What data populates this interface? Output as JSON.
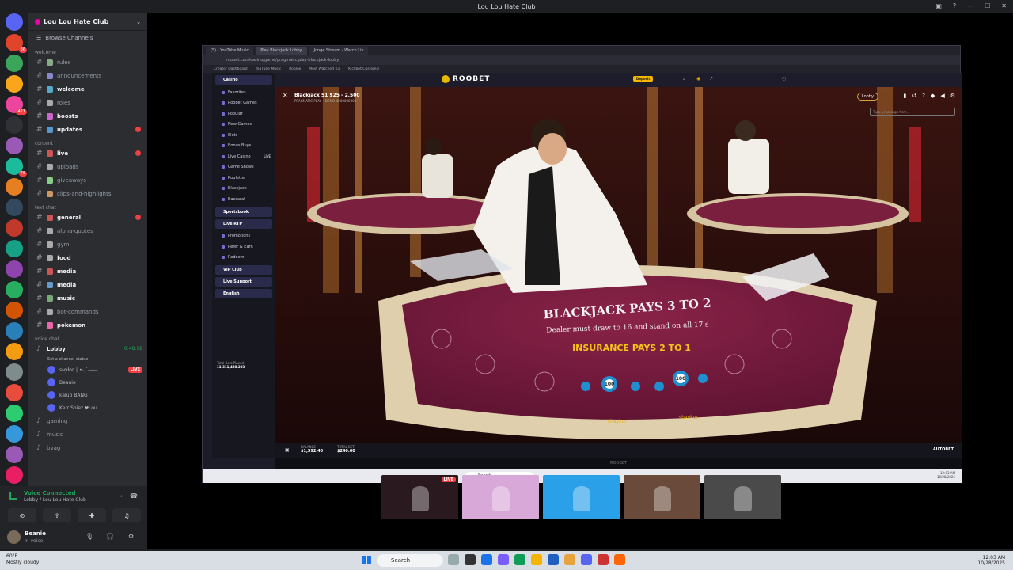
{
  "window": {
    "title": "Lou Lou Hate Club"
  },
  "server": {
    "name": "Lou Lou Hate Club",
    "browse_label": "Browse Channels",
    "categories": [
      {
        "name": "welcome",
        "channels": [
          {
            "name": "rules",
            "bold": false,
            "ping": false
          },
          {
            "name": "announcements",
            "bold": false,
            "ping": false
          },
          {
            "name": "welcome",
            "bold": true,
            "ping": false
          },
          {
            "name": "roles",
            "bold": false,
            "ping": false
          },
          {
            "name": "boosts",
            "bold": true,
            "ping": false
          },
          {
            "name": "updates",
            "bold": true,
            "ping": true
          }
        ]
      },
      {
        "name": "content",
        "channels": [
          {
            "name": "live",
            "bold": true,
            "ping": true
          },
          {
            "name": "uploads",
            "bold": false,
            "ping": false
          },
          {
            "name": "giveaways",
            "bold": false,
            "ping": false
          },
          {
            "name": "clips-and-highlights",
            "bold": false,
            "ping": false
          }
        ]
      },
      {
        "name": "text chat",
        "channels": [
          {
            "name": "general",
            "bold": true,
            "ping": true
          },
          {
            "name": "alpha-quotes",
            "bold": false,
            "ping": false
          },
          {
            "name": "gym",
            "bold": false,
            "ping": false
          },
          {
            "name": "food",
            "bold": true,
            "ping": false
          },
          {
            "name": "media",
            "bold": true,
            "ping": false
          },
          {
            "name": "media",
            "bold": true,
            "ping": false
          },
          {
            "name": "music",
            "bold": true,
            "ping": false
          },
          {
            "name": "bot-commands",
            "bold": false,
            "ping": false
          },
          {
            "name": "pokemon",
            "bold": true,
            "ping": false
          }
        ]
      }
    ],
    "voice_category": "voice chat",
    "voice_channel": {
      "name": "Lobby",
      "timer": "0:48:58",
      "status": "Set a channel status"
    },
    "voice_users": [
      {
        "name": "ѕнyłог | •˗ˏˋ――",
        "live": true
      },
      {
        "name": "Beanie",
        "live": false
      },
      {
        "name": "kalub BANG",
        "live": false
      },
      {
        "name": "Kerr Soiez ❤Lou",
        "live": false
      }
    ],
    "live_label": "LIVE",
    "extra_voice": [
      "gaming",
      "music",
      "bvag"
    ]
  },
  "guild_pings": [
    "36",
    "421",
    "76",
    "55",
    "8",
    "363",
    "233",
    "267",
    "NEW"
  ],
  "voice_panel": {
    "title": "Voice Connected",
    "subtitle": "Lobby / Lou Lou Hate Club"
  },
  "user": {
    "name": "Beanie",
    "status": "In voice"
  },
  "browser": {
    "tabs": [
      {
        "label": "(5) - YouTube Music",
        "active": false
      },
      {
        "label": "Play Blackjack Lobby",
        "active": true
      },
      {
        "label": "Jonge Stream - Watch Liv",
        "active": false
      }
    ],
    "url": "roobet.com/casino/game/pragmatic-play-blackjack-lobby",
    "bookmarks": [
      "Creator Dashboard",
      "YouTube Music",
      "Roblox",
      "Most Watched Kic",
      "Kickbot Customiz"
    ]
  },
  "roobet": {
    "logo": "ROOBET",
    "deposit": "Deposit",
    "nav": [
      {
        "label": "Casino",
        "type": "section"
      },
      {
        "label": "Favorites"
      },
      {
        "label": "Roobet Games"
      },
      {
        "label": "Popular"
      },
      {
        "label": "New Games"
      },
      {
        "label": "Slots"
      },
      {
        "label": "Bonus Buys"
      },
      {
        "label": "Live Casino",
        "tag": "LIVE"
      },
      {
        "label": "Game Shows"
      },
      {
        "label": "Roulette"
      },
      {
        "label": "Blackjack"
      },
      {
        "label": "Baccarat"
      },
      {
        "label": "Sportsbook",
        "type": "section"
      },
      {
        "label": "Live RTP",
        "type": "section"
      },
      {
        "label": "Promotions"
      },
      {
        "label": "Refer & Earn"
      },
      {
        "label": "Redeem"
      },
      {
        "label": "VIP Club",
        "type": "section"
      },
      {
        "label": "Live Support",
        "type": "section"
      },
      {
        "label": "English",
        "type": "section"
      }
    ],
    "total_bets_label": "Total Bets Placed",
    "total_bets_value": "11,311,428,203",
    "game_title": "Blackjack 51 $25 - 2,500",
    "game_sub": "PRAGMATIC PLAY • DEMO ID 00000000",
    "lobby_btn": "Lobby",
    "message_placeholder": "Type a message here...",
    "table_text": [
      "BLACKJACK PAYS 3 TO 2",
      "Dealer must draw to 16 and stand on all 17's",
      "INSURANCE PAYS 2 TO 1"
    ],
    "balance_label": "BALANCE",
    "balance_value": "$1,592.40",
    "total_bet_label": "TOTAL BET",
    "total_bet_value": "$240.00",
    "autobet": "AUTOBET",
    "footer_logo": "ROOBET",
    "chip_values": [
      "100",
      "100"
    ],
    "overlay_names": [
      "shaykur",
      "shaykur"
    ]
  },
  "inner_taskbar": {
    "search": "Search",
    "time": "12:03 AM",
    "date": "10/28/2025"
  },
  "taskbar": {
    "weather_temp": "60°F",
    "weather_desc": "Mostly cloudy",
    "search": "Search",
    "time": "12:03 AM",
    "date": "10/28/2025"
  },
  "stream_thumbs": [
    {
      "live": true
    },
    {
      "live": false
    },
    {
      "live": false
    },
    {
      "live": false
    },
    {
      "live": false
    }
  ],
  "colors": {
    "accent": "#5865f2",
    "live": "#f23f43",
    "voice": "#23a55a",
    "felt": "#7a1f3e",
    "gold": "#f5b700"
  }
}
